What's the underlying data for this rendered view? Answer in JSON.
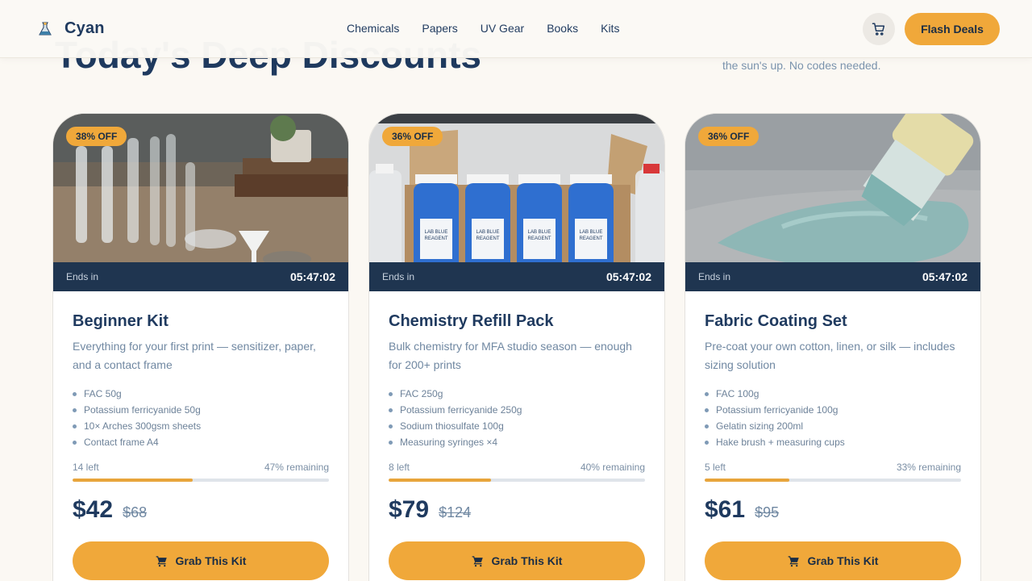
{
  "brand": {
    "name": "Cyan",
    "logo_icon": "flask-logo-icon"
  },
  "nav": {
    "items": [
      "Chemicals",
      "Papers",
      "UV Gear",
      "Books",
      "Kits"
    ]
  },
  "header": {
    "cart_icon": "cart-icon",
    "flash_deals_label": "Flash Deals"
  },
  "hero": {
    "title": "Today's Deep Discounts",
    "subtitle_fragment": "the sun's up. No codes needed."
  },
  "colors": {
    "accent": "#f0a83a",
    "navy": "#1f3a5f",
    "timer_bg": "#1f3550",
    "page_bg": "#fbf8f3"
  },
  "cards": [
    {
      "badge": "38% OFF",
      "image_icon": "glassware-photo",
      "ends_label": "Ends in",
      "timer": "05:47:02",
      "title": "Beginner Kit",
      "description": "Everything for your first print — sensitizer, paper, and a contact frame",
      "features": [
        "FAC 50g",
        "Potassium ferricyanide 50g",
        "10× Arches 300gsm sheets",
        "Contact frame A4"
      ],
      "stock_left": "14 left",
      "remaining_label": "47% remaining",
      "remaining_fraction": 0.47,
      "price": "$42",
      "old_price": "$68",
      "button_label": "Grab This Kit"
    },
    {
      "badge": "36% OFF",
      "image_icon": "reagent-bottles-photo",
      "ends_label": "Ends in",
      "timer": "05:47:02",
      "title": "Chemistry Refill Pack",
      "description": "Bulk chemistry for MFA studio season — enough for 200+ prints",
      "features": [
        "FAC 250g",
        "Potassium ferricyanide 250g",
        "Sodium thiosulfate 100g",
        "Measuring syringes ×4"
      ],
      "stock_left": "8 left",
      "remaining_label": "40% remaining",
      "remaining_fraction": 0.4,
      "price": "$79",
      "old_price": "$124",
      "button_label": "Grab This Kit"
    },
    {
      "badge": "36% OFF",
      "image_icon": "fabric-brush-photo",
      "ends_label": "Ends in",
      "timer": "05:47:02",
      "title": "Fabric Coating Set",
      "description": "Pre-coat your own cotton, linen, or silk — includes sizing solution",
      "features": [
        "FAC 100g",
        "Potassium ferricyanide 100g",
        "Gelatin sizing 200ml",
        "Hake brush + measuring cups"
      ],
      "stock_left": "5 left",
      "remaining_label": "33% remaining",
      "remaining_fraction": 0.33,
      "price": "$61",
      "old_price": "$95",
      "button_label": "Grab This Kit"
    }
  ],
  "bottle_label": {
    "line1": "LAB BLUE",
    "line2": "REAGENT"
  }
}
